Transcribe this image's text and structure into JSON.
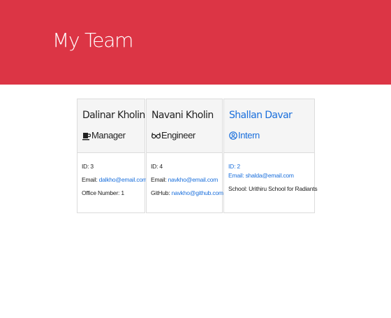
{
  "header": {
    "title": "My Team"
  },
  "team": [
    {
      "name": "Dalinar Kholin",
      "role": "Manager",
      "icon": "coffee-icon",
      "id_label": "ID: 3",
      "email_prefix": "Email: ",
      "email": "dalkho@email.com",
      "extra_label": "Office Number: 1"
    },
    {
      "name": "Navani Kholin",
      "role": "Engineer",
      "icon": "glasses-icon",
      "id_label": "ID: 4",
      "email_prefix": "Email: ",
      "email": "navkho@email.com",
      "extra_prefix": "GitHub: ",
      "extra_link": "navkho@github.com"
    },
    {
      "name": "Shallan Davar",
      "role": "Intern",
      "icon": "user-circle-icon",
      "id_label": "ID: 2",
      "email_prefix": "Email: ",
      "email": "shalda@email.com",
      "extra_label": "School: Urithiru School for Radiants"
    }
  ],
  "colors": {
    "header_bg": "#dc3545",
    "link": "#1a6fdc"
  }
}
